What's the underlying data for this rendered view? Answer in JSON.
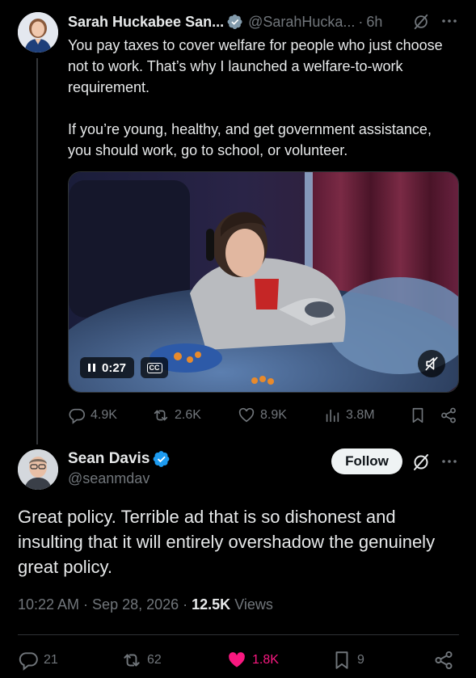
{
  "quoted_post": {
    "author_name": "Sarah Huckabee San...",
    "handle": "@SarahHucka...",
    "separator": "·",
    "time": "6h",
    "text_p1": "You pay taxes to cover welfare for people who just choose not to work. That’s why I launched a welfare-to-work requirement.",
    "text_p2": "If you’re young, healthy, and get government assistance, you should work, go to school, or volunteer.",
    "video": {
      "elapsed": "0:27",
      "captions_label": "CC",
      "state": "playing",
      "muted": true
    },
    "actions": {
      "replies": "4.9K",
      "reposts": "2.6K",
      "likes": "8.9K",
      "views": "3.8M"
    }
  },
  "main_post": {
    "author_name": "Sean Davis",
    "handle": "@seanmdav",
    "follow_label": "Follow",
    "text": "Great policy. Terrible ad that is so dishonest and insulting that it will entirely overshadow the genuinely great policy.",
    "timestamp": "10:22 AM · Sep 28, 2026 · ",
    "views_count": "12.5K",
    "views_label": "Views",
    "actions": {
      "replies": "21",
      "reposts": "62",
      "likes": "1.8K",
      "bookmarks": "9"
    }
  },
  "icons": {
    "verified": "verified-badge-icon",
    "grok": "grok-icon",
    "more": "more-icon",
    "reply": "reply-icon",
    "repost": "repost-icon",
    "like": "heart-icon",
    "views": "views-icon",
    "bookmark": "bookmark-icon",
    "share": "share-icon",
    "pause": "pause-icon",
    "mute": "mute-icon"
  },
  "colors": {
    "background": "#000000",
    "text": "#e7e9ea",
    "muted": "#71767b",
    "verified": "#1d9bf0",
    "like": "#f91880",
    "follow_bg": "#eff3f4"
  }
}
